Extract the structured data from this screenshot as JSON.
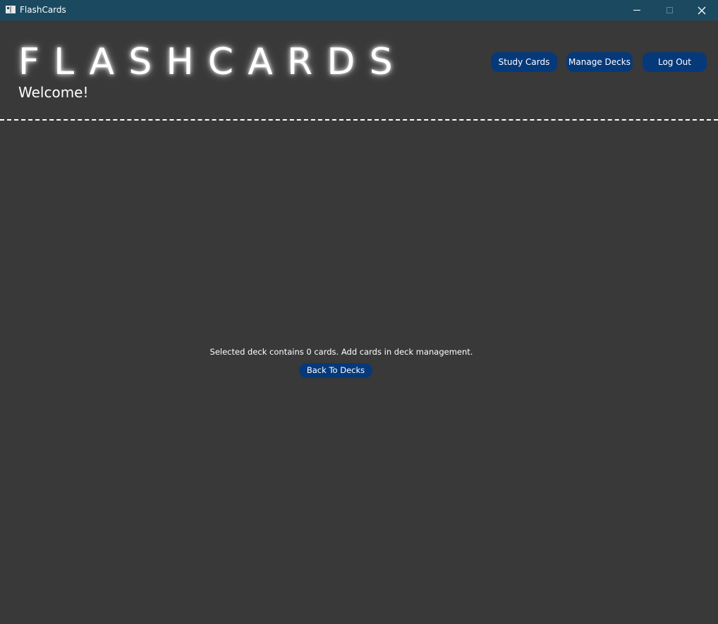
{
  "window": {
    "title": "FlashCards",
    "controls": {
      "minimize_icon": "minimize-icon",
      "maximize_icon": "maximize-icon",
      "close_icon": "close-icon"
    }
  },
  "header": {
    "logo_text": "FLASHCARDS",
    "welcome_text": "Welcome!",
    "nav": {
      "study_label": "Study Cards",
      "manage_label": "Manage Decks",
      "logout_label": "Log Out"
    }
  },
  "main": {
    "message": "Selected deck contains 0 cards. Add cards in deck management.",
    "back_label": "Back To Decks"
  },
  "colors": {
    "titlebar": "#1b4a60",
    "background": "#393939",
    "button": "#06397a",
    "text": "#ffffff"
  }
}
